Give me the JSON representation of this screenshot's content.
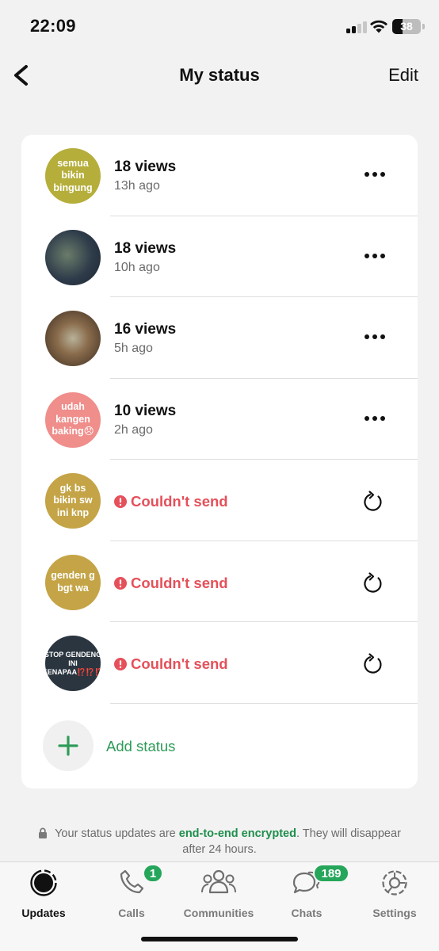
{
  "status_bar": {
    "time": "22:09",
    "battery": "38"
  },
  "nav": {
    "title": "My status",
    "edit_label": "Edit"
  },
  "statuses": [
    {
      "avatar_text": "semua bikin bingung",
      "avatar_color": "#b5ae3a",
      "type": "sent",
      "views": "18 views",
      "ago": "13h ago"
    },
    {
      "avatar_text": "",
      "avatar_color": "#3a4a58",
      "type": "sent",
      "views": "18 views",
      "ago": "10h ago"
    },
    {
      "avatar_text": "",
      "avatar_color": "#6e5a3d",
      "type": "sent",
      "views": "16 views",
      "ago": "5h ago"
    },
    {
      "avatar_text": "udah kangen baking😞",
      "avatar_color": "#ef8e8b",
      "type": "sent",
      "views": "10 views",
      "ago": "2h ago"
    },
    {
      "avatar_text": "gk bs bikin sw ini knp",
      "avatar_color": "#c4a446",
      "type": "failed",
      "error": "Couldn't send"
    },
    {
      "avatar_text": "genden g bgt wa",
      "avatar_color": "#c4a446",
      "type": "failed",
      "error": "Couldn't send"
    },
    {
      "avatar_text": "STOP GENDENG INI KENAPAA⁉️⁉️⁉️",
      "avatar_color": "#2a3540",
      "type": "failed",
      "error": "Couldn't send"
    }
  ],
  "add_status": {
    "label": "Add status"
  },
  "footer_note": {
    "before": "Your status updates are ",
    "highlight": "end-to-end encrypted",
    "after": ". They will disappear after 24 hours."
  },
  "tabs": [
    {
      "label": "Updates",
      "icon": "updates-icon",
      "active": true
    },
    {
      "label": "Calls",
      "icon": "phone-icon",
      "badge": "1"
    },
    {
      "label": "Communities",
      "icon": "communities-icon"
    },
    {
      "label": "Chats",
      "icon": "chat-bubbles-icon",
      "badge": "189"
    },
    {
      "label": "Settings",
      "icon": "gear-icon"
    }
  ],
  "colors": {
    "accent_green": "#25a65a",
    "error_red": "#e5505a"
  }
}
